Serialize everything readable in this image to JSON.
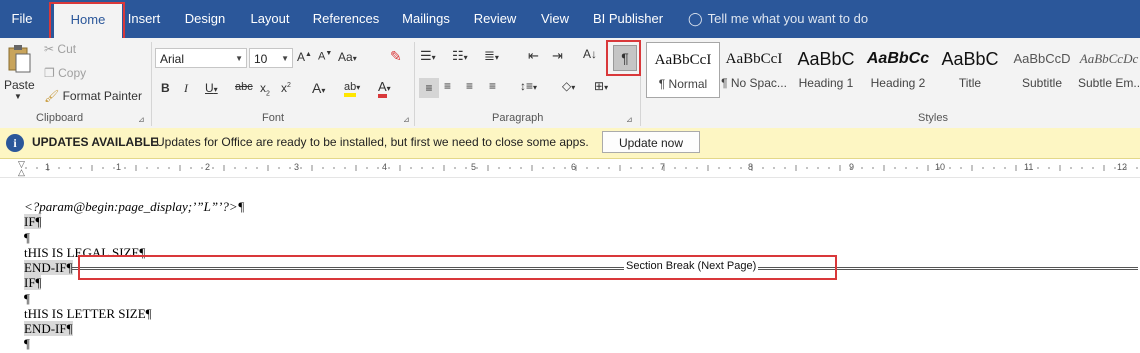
{
  "tabs": [
    {
      "label": "File",
      "active": false
    },
    {
      "label": "Home",
      "active": true
    },
    {
      "label": "Insert",
      "active": false
    },
    {
      "label": "Design",
      "active": false
    },
    {
      "label": "Layout",
      "active": false
    },
    {
      "label": "References",
      "active": false
    },
    {
      "label": "Mailings",
      "active": false
    },
    {
      "label": "Review",
      "active": false
    },
    {
      "label": "View",
      "active": false
    },
    {
      "label": "BI Publisher",
      "active": false
    }
  ],
  "tell_me": "Tell me what you want to do",
  "clipboard": {
    "paste": "Paste",
    "cut": "Cut",
    "copy": "Copy",
    "format_painter": "Format Painter",
    "label": "Clipboard"
  },
  "font": {
    "name": "Arial",
    "size": "10",
    "label": "Font"
  },
  "paragraph": {
    "label": "Paragraph",
    "show_marks_glyph": "¶"
  },
  "styles": {
    "label": "Styles",
    "items": [
      {
        "preview": "AaBbCcI",
        "name": "¶ Normal"
      },
      {
        "preview": "AaBbCcI",
        "name": "¶ No Spac..."
      },
      {
        "preview": "AaBbC",
        "name": "Heading 1"
      },
      {
        "preview": "AaBbCc",
        "name": "Heading 2"
      },
      {
        "preview": "AaBbC",
        "name": "Title"
      },
      {
        "preview": "AaBbCcD",
        "name": "Subtitle"
      },
      {
        "preview": "AaBbCcDc",
        "name": "Subtle Em..."
      }
    ]
  },
  "notification": {
    "title": "UPDATES AVAILABLE",
    "message": "Updates for Office are ready to be installed, but first we need to close some apps.",
    "button": "Update now"
  },
  "ruler_numbers": [
    "1",
    "1",
    "2",
    "3",
    "4",
    "5",
    "6",
    "7",
    "8",
    "9",
    "10",
    "11",
    "12"
  ],
  "document": {
    "line1": "<?param@begin:page_display;’”L”’?>¶",
    "line2": "IF¶",
    "line3": "¶",
    "line4": "tHIS IS LEGAL SIZE¶",
    "line5": "END-IF¶",
    "section_break": "Section Break (Next Page)",
    "line6": "IF¶",
    "line7": "¶",
    "line8": "tHIS IS LETTER SIZE¶",
    "line9": "END-IF¶",
    "line10": "¶"
  }
}
